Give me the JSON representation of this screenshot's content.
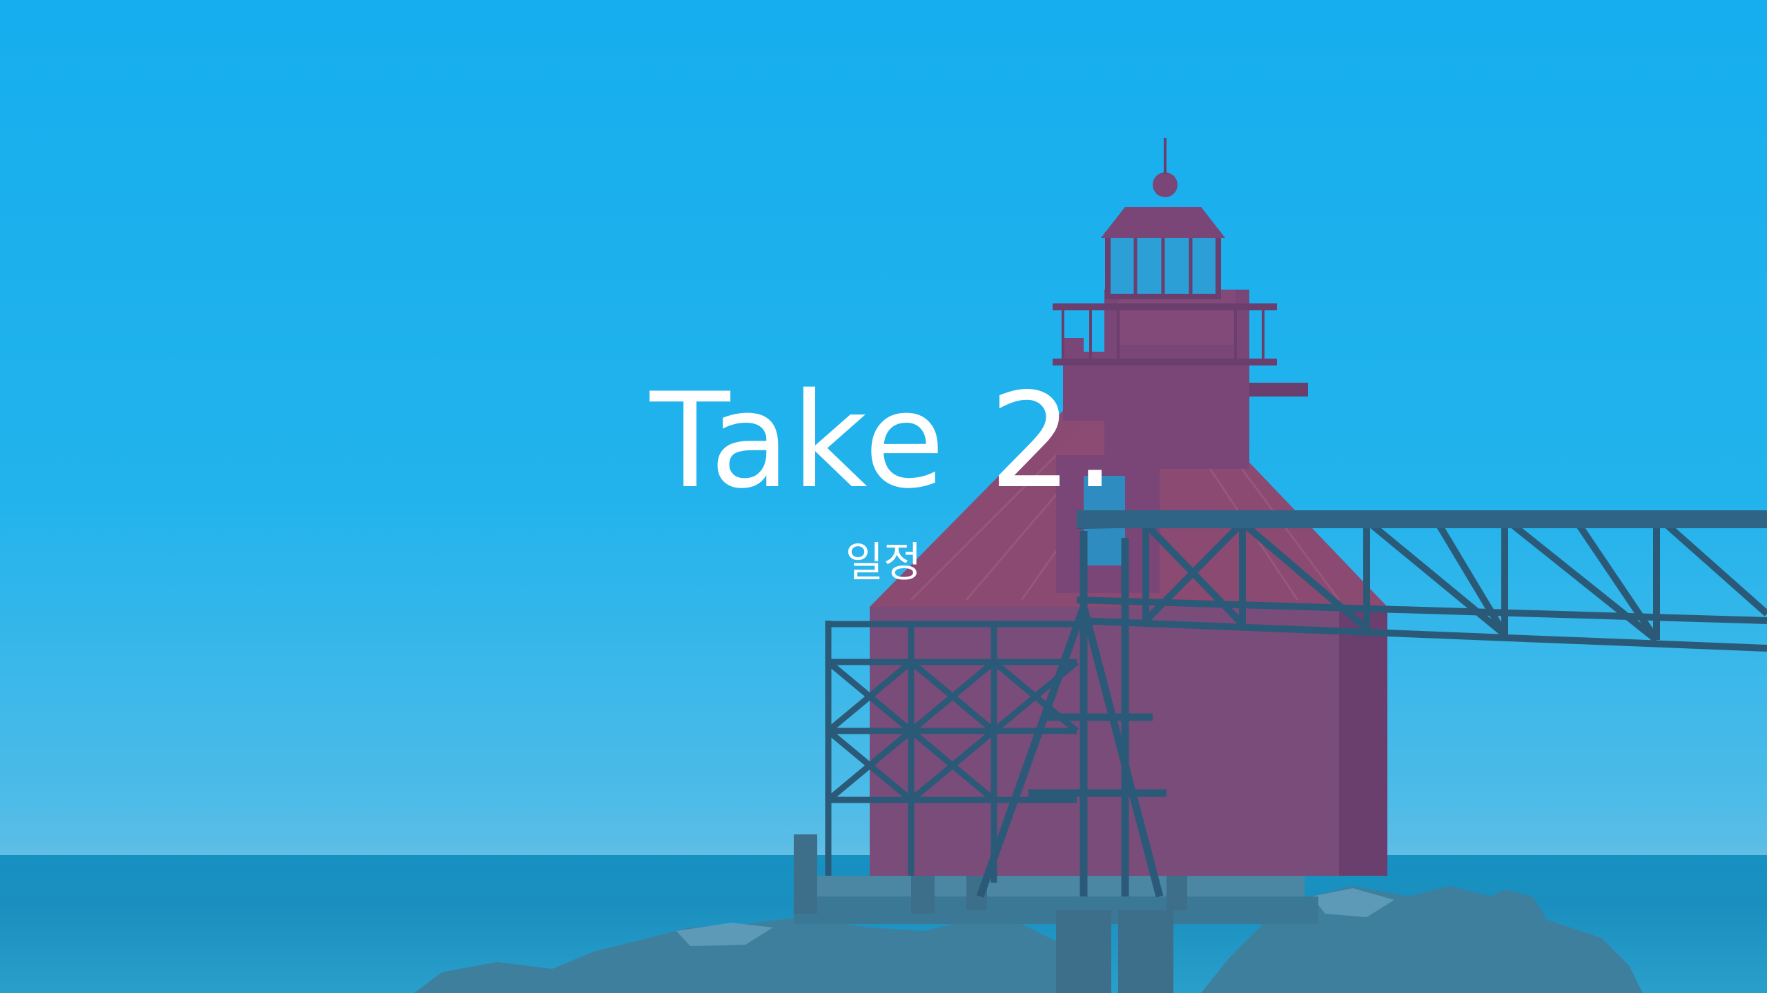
{
  "slide": {
    "title": "Take 2.",
    "subtitle": "일정"
  },
  "background": {
    "description_icon": "lighthouse-photo",
    "overlay_color": "#1eaeea"
  }
}
